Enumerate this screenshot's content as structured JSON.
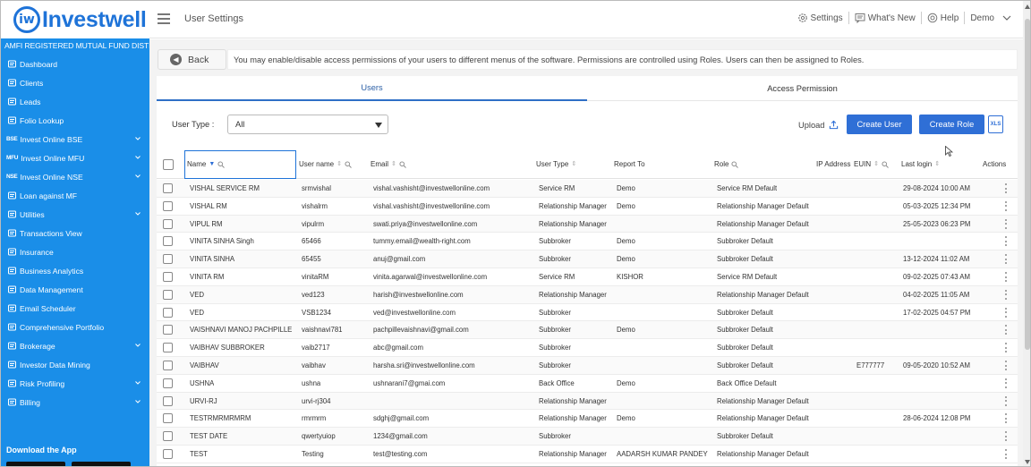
{
  "brand": {
    "logo_letter": "iw",
    "name": "Investwell"
  },
  "sidebar": {
    "subtitle": "AMFI REGISTERED MUTUAL FUND DISTRIBUTOR",
    "items": [
      {
        "label": "Dashboard",
        "icon": "home-icon",
        "prefix": "",
        "chevron": false
      },
      {
        "label": "Clients",
        "icon": "clients-icon",
        "prefix": "",
        "chevron": false
      },
      {
        "label": "Leads",
        "icon": "leads-icon",
        "prefix": "",
        "chevron": false
      },
      {
        "label": "Folio Lookup",
        "icon": "folio-icon",
        "prefix": "",
        "chevron": false
      },
      {
        "label": "Invest Online BSE",
        "icon": "",
        "prefix": "BSE",
        "chevron": true
      },
      {
        "label": "Invest Online MFU",
        "icon": "",
        "prefix": "MFU",
        "chevron": true
      },
      {
        "label": "Invest Online NSE",
        "icon": "",
        "prefix": "NSE",
        "chevron": true
      },
      {
        "label": "Loan against MF",
        "icon": "loan-icon",
        "prefix": "",
        "chevron": false
      },
      {
        "label": "Utilities",
        "icon": "utilities-icon",
        "prefix": "",
        "chevron": true
      },
      {
        "label": "Transactions View",
        "icon": "transactions-icon",
        "prefix": "",
        "chevron": false
      },
      {
        "label": "Insurance",
        "icon": "insurance-icon",
        "prefix": "",
        "chevron": false
      },
      {
        "label": "Business Analytics",
        "icon": "analytics-icon",
        "prefix": "",
        "chevron": false
      },
      {
        "label": "Data Management",
        "icon": "data-icon",
        "prefix": "",
        "chevron": false
      },
      {
        "label": "Email Scheduler",
        "icon": "email-icon",
        "prefix": "",
        "chevron": false
      },
      {
        "label": "Comprehensive Portfolio",
        "icon": "portfolio-icon",
        "prefix": "",
        "chevron": false
      },
      {
        "label": "Brokerage",
        "icon": "brokerage-icon",
        "prefix": "",
        "chevron": true
      },
      {
        "label": "Investor Data Mining",
        "icon": "mining-icon",
        "prefix": "",
        "chevron": false
      },
      {
        "label": "Risk Profiling",
        "icon": "risk-icon",
        "prefix": "",
        "chevron": true
      },
      {
        "label": "Billing",
        "icon": "billing-icon",
        "prefix": "",
        "chevron": true
      }
    ],
    "download_label": "Download the App"
  },
  "header": {
    "title": "User Settings",
    "nav": [
      {
        "label": "Settings",
        "icon": "gear-icon"
      },
      {
        "label": "What's New",
        "icon": "whats-new-icon"
      },
      {
        "label": "Help",
        "icon": "help-icon"
      },
      {
        "label": "Demo",
        "icon": "chevron-down-icon"
      }
    ]
  },
  "main": {
    "back_label": "Back",
    "info_text": "You may enable/disable access permissions of your users to different menus of the software. Permissions are controlled using Roles. Users can then be assigned to Roles.",
    "tabs": [
      {
        "label": "Users",
        "active": true
      },
      {
        "label": "Access Permission",
        "active": false
      }
    ],
    "user_type_label": "User Type :",
    "user_type_value": "All",
    "upload_label": "Upload",
    "create_user_label": "Create User",
    "create_role_label": "Create Role",
    "xls_label": "XLS"
  },
  "table": {
    "columns": [
      "Name",
      "User name",
      "Email",
      "User Type",
      "Report To",
      "Role",
      "IP Address",
      "EUIN",
      "Last login",
      "Actions"
    ],
    "rows": [
      [
        "VISHAL SERVICE RM",
        "srmvishal",
        "vishal.vashisht@investwellonline.com",
        "Service RM",
        "Demo",
        "Service RM Default",
        "",
        "",
        "29-08-2024 10:00 AM"
      ],
      [
        "VISHAL RM",
        "vishalrm",
        "vishal.vashisht@investwellonline.com",
        "Relationship Manager",
        "Demo",
        "Relationship Manager Default",
        "",
        "",
        "05-03-2025 12:34 PM"
      ],
      [
        "VIPUL RM",
        "vipulrm",
        "swati.priya@investwellonline.com",
        "Relationship Manager",
        "",
        "Relationship Manager Default",
        "",
        "",
        "25-05-2023 06:23 PM"
      ],
      [
        "VINITA SINHA Singh",
        "65466",
        "tummy.email@wealth-right.com",
        "Subbroker",
        "Demo",
        "Subbroker Default",
        "",
        "",
        ""
      ],
      [
        "VINITA SINHA",
        "65455",
        "anuj@gmail.com",
        "Subbroker",
        "Demo",
        "Subbroker Default",
        "",
        "",
        "13-12-2024 11:02 AM"
      ],
      [
        "VINITA RM",
        "vinitaRM",
        "vinita.agarwal@investwellonline.com",
        "Service RM",
        "KISHOR",
        "Service RM Default",
        "",
        "",
        "09-02-2025 07:43 AM"
      ],
      [
        "VED",
        "ved123",
        "harish@investwellonline.com",
        "Relationship Manager",
        "",
        "Relationship Manager Default",
        "",
        "",
        "04-02-2025 11:05 AM"
      ],
      [
        "VED",
        "VSB1234",
        "ved@investwellonline.com",
        "Subbroker",
        "",
        "Subbroker Default",
        "",
        "",
        "17-02-2025 04:57 PM"
      ],
      [
        "VAISHNAVI MANOJ PACHPILLE",
        "vaishnavi781",
        "pachpillevaishnavi@gmail.com",
        "Subbroker",
        "Demo",
        "Subbroker Default",
        "",
        "",
        ""
      ],
      [
        "VAIBHAV SUBBROKER",
        "vaib2717",
        "abc@gmail.com",
        "Subbroker",
        "",
        "Subbroker Default",
        "",
        "",
        ""
      ],
      [
        "VAIBHAV",
        "vaibhav",
        "harsha.sri@investwellonline.com",
        "Subbroker",
        "",
        "Subbroker Default",
        "",
        "E777777",
        "09-05-2020 10:52 AM"
      ],
      [
        "USHNA",
        "ushna",
        "ushnarani7@gmai.com",
        "Back Office",
        "Demo",
        "Back Office Default",
        "",
        "",
        ""
      ],
      [
        "URVI-RJ",
        "urvi-rj304",
        "",
        "Relationship Manager",
        "",
        "Relationship Manager Default",
        "",
        "",
        ""
      ],
      [
        "TESTRMRMRMRM",
        "rmrmrm",
        "sdghj@gmail.com",
        "Relationship Manager",
        "Demo",
        "Relationship Manager Default",
        "",
        "",
        "28-06-2024 12:08 PM"
      ],
      [
        "TEST DATE",
        "qwertyuiop",
        "1234@gmail.com",
        "Subbroker",
        "",
        "Subbroker Default",
        "",
        "",
        ""
      ],
      [
        "TEST",
        "Testing",
        "test@testing.com",
        "Relationship Manager",
        "AADARSH KUMAR PANDEY",
        "Relationship Manager Default",
        "",
        "",
        ""
      ]
    ]
  },
  "colors": {
    "sidebar": "#1a8ee8",
    "accent": "#2f6fd6",
    "brand": "#1e73d8"
  }
}
